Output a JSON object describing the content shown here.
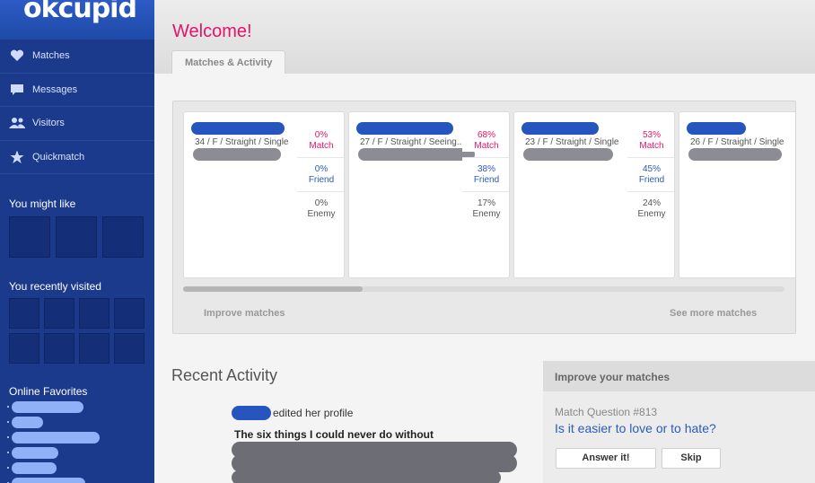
{
  "app": {
    "logo_text": "okcupid"
  },
  "sidebar": {
    "nav": [
      {
        "label": "Matches",
        "icon": "heart-icon"
      },
      {
        "label": "Messages",
        "icon": "speech-bubble-icon"
      },
      {
        "label": "Visitors",
        "icon": "people-icon"
      },
      {
        "label": "Quickmatch",
        "icon": "star-icon"
      }
    ],
    "might_like_heading": "You might like",
    "recently_visited_heading": "You recently visited",
    "online_favorites_heading": "Online Favorites"
  },
  "header": {
    "welcome": "Welcome!",
    "tab_label": "Matches & Activity"
  },
  "matches": {
    "cards": [
      {
        "desc": "34 / F / Straight / Single",
        "match": "0%",
        "friend": "0%",
        "enemy": "0%"
      },
      {
        "desc": "27 / F / Straight / Seeing...",
        "match": "68%",
        "friend": "38%",
        "enemy": "17%"
      },
      {
        "desc": "23 / F / Straight / Single",
        "match": "53%",
        "friend": "45%",
        "enemy": "24%"
      },
      {
        "desc": "26 / F / Straight / Single",
        "match": "",
        "friend": "",
        "enemy": ""
      }
    ],
    "stat_labels": {
      "match": "Match",
      "friend": "Friend",
      "enemy": "Enemy"
    },
    "improve_link": "Improve matches",
    "see_more_link": "See more matches"
  },
  "recent_activity": {
    "title": "Recent Activity",
    "action_text": "edited her profile",
    "item_title": "The six things I could never do without"
  },
  "improve_box": {
    "heading": "Improve your matches",
    "question_number": "Match Question #813",
    "question": "Is it easier to love or to hate?",
    "answer_button": "Answer it!",
    "skip_button": "Skip"
  },
  "colors": {
    "sidebar_bg": "#1b3a8c",
    "brand_pink": "#e5136c",
    "link_blue": "#2b5bb8"
  }
}
